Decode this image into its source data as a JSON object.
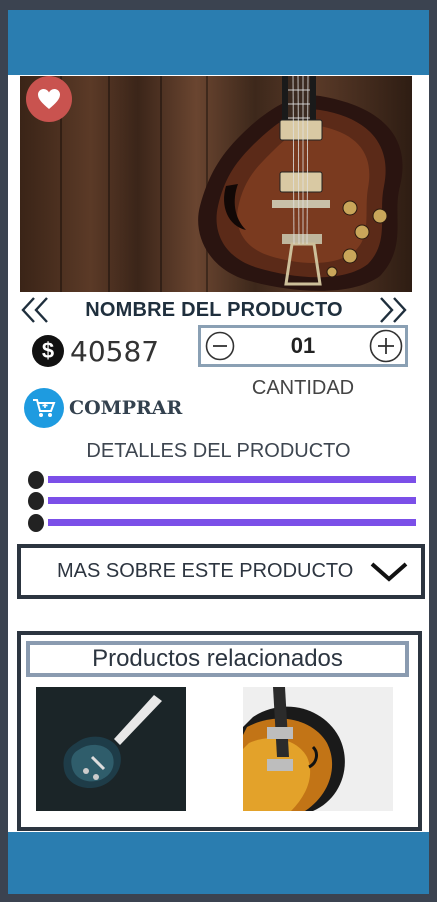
{
  "header": {
    "color": "#2a7db0"
  },
  "footer": {
    "color": "#2a7db0"
  },
  "product": {
    "name": "NOMBRE DEL PRODUCTO",
    "price": "40587",
    "currency_symbol": "$",
    "quantity": "01",
    "quantity_label": "CANTIDAD",
    "buy_label": "COMPRAR",
    "details_title": "DETALLES DEL PRODUCTO",
    "more_label": "MAS SOBRE ESTE PRODUCTO"
  },
  "icons": {
    "favorite": "heart-icon",
    "prev": "double-chevron-left-icon",
    "next": "double-chevron-right-icon",
    "decrement": "minus-circle-icon",
    "increment": "plus-circle-icon",
    "cart": "cart-icon",
    "expand": "chevron-down-icon"
  },
  "related": {
    "title": "Productos relacionados"
  },
  "colors": {
    "accent_purple": "#7b4fe8",
    "heart_red": "#c9534f",
    "cart_blue": "#1e9be0"
  }
}
